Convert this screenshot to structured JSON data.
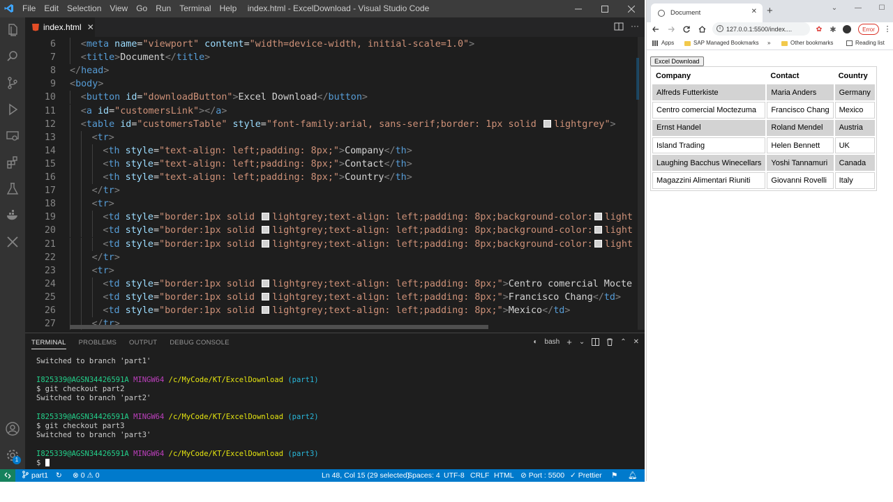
{
  "vscode": {
    "window_title": "index.html - ExcelDownload - Visual Studio Code",
    "menu": [
      "File",
      "Edit",
      "Selection",
      "View",
      "Go",
      "Run",
      "Terminal",
      "Help"
    ],
    "tab_label": "index.html",
    "code_lines": [
      {
        "n": "6",
        "html": "<span class='pun'>&lt;</span><span class='tag'>meta</span> <span class='att'>name</span><span class='txt'>=</span><span class='str'>\"viewport\"</span> <span class='att'>content</span><span class='txt'>=</span><span class='str'>\"width=device-width, initial-scale=1.0\"</span><span class='pun'>&gt;</span>",
        "indent": 2
      },
      {
        "n": "7",
        "html": "<span class='pun'>&lt;</span><span class='tag'>title</span><span class='pun'>&gt;</span><span class='txt'>Document</span><span class='pun'>&lt;/</span><span class='tag'>title</span><span class='pun'>&gt;</span>",
        "indent": 2
      },
      {
        "n": "8",
        "html": "<span class='pun'>&lt;/</span><span class='tag'>head</span><span class='pun'>&gt;</span>",
        "indent": 0
      },
      {
        "n": "9",
        "html": "<span class='pun'>&lt;</span><span class='tag'>body</span><span class='pun'>&gt;</span>",
        "indent": 0
      },
      {
        "n": "10",
        "html": "<span class='pun'>&lt;</span><span class='tag'>button</span> <span class='att'>id</span><span class='txt'>=</span><span class='str'>\"downloadButton\"</span><span class='pun'>&gt;</span><span class='txt'>Excel Download</span><span class='pun'>&lt;/</span><span class='tag'>button</span><span class='pun'>&gt;</span>",
        "indent": 2
      },
      {
        "n": "11",
        "html": "<span class='pun'>&lt;</span><span class='tag'>a</span> <span class='att'>id</span><span class='txt'>=</span><span class='str'>\"customersLink\"</span><span class='pun'>&gt;&lt;/</span><span class='tag'>a</span><span class='pun'>&gt;</span>",
        "indent": 2
      },
      {
        "n": "12",
        "html": "<span class='pun'>&lt;</span><span class='tag'>table</span> <span class='att'>id</span><span class='txt'>=</span><span class='str'>\"customersTable\"</span> <span class='att'>style</span><span class='txt'>=</span><span class='str'>\"font-family:arial, sans-serif;border: 1px solid <span class='sw'></span>lightgrey\"</span><span class='pun'>&gt;</span>",
        "indent": 2
      },
      {
        "n": "13",
        "html": "<span class='pun'>&lt;</span><span class='tag'>tr</span><span class='pun'>&gt;</span>",
        "indent": 4
      },
      {
        "n": "14",
        "html": "<span class='pun'>&lt;</span><span class='tag'>th</span> <span class='att'>style</span><span class='txt'>=</span><span class='str'>\"text-align: left;padding: 8px;\"</span><span class='pun'>&gt;</span><span class='txt'>Company</span><span class='pun'>&lt;/</span><span class='tag'>th</span><span class='pun'>&gt;</span>",
        "indent": 6
      },
      {
        "n": "15",
        "html": "<span class='pun'>&lt;</span><span class='tag'>th</span> <span class='att'>style</span><span class='txt'>=</span><span class='str'>\"text-align: left;padding: 8px;\"</span><span class='pun'>&gt;</span><span class='txt'>Contact</span><span class='pun'>&lt;/</span><span class='tag'>th</span><span class='pun'>&gt;</span>",
        "indent": 6
      },
      {
        "n": "16",
        "html": "<span class='pun'>&lt;</span><span class='tag'>th</span> <span class='att'>style</span><span class='txt'>=</span><span class='str'>\"text-align: left;padding: 8px;\"</span><span class='pun'>&gt;</span><span class='txt'>Country</span><span class='pun'>&lt;/</span><span class='tag'>th</span><span class='pun'>&gt;</span>",
        "indent": 6
      },
      {
        "n": "17",
        "html": "<span class='pun'>&lt;/</span><span class='tag'>tr</span><span class='pun'>&gt;</span>",
        "indent": 4
      },
      {
        "n": "18",
        "html": "<span class='pun'>&lt;</span><span class='tag'>tr</span><span class='pun'>&gt;</span>",
        "indent": 4
      },
      {
        "n": "19",
        "html": "<span class='pun'>&lt;</span><span class='tag'>td</span> <span class='att'>style</span><span class='txt'>=</span><span class='str'>\"border:1px solid <span class='sw'></span>lightgrey;text-align: left;padding: 8px;background-color:<span class='sw'></span>light</span>",
        "indent": 6
      },
      {
        "n": "20",
        "html": "<span class='pun'>&lt;</span><span class='tag'>td</span> <span class='att'>style</span><span class='txt'>=</span><span class='str'>\"border:1px solid <span class='sw'></span>lightgrey;text-align: left;padding: 8px;background-color:<span class='sw'></span>light</span>",
        "indent": 6
      },
      {
        "n": "21",
        "html": "<span class='pun'>&lt;</span><span class='tag'>td</span> <span class='att'>style</span><span class='txt'>=</span><span class='str'>\"border:1px solid <span class='sw'></span>lightgrey;text-align: left;padding: 8px;background-color:<span class='sw'></span>light</span>",
        "indent": 6
      },
      {
        "n": "22",
        "html": "<span class='pun'>&lt;/</span><span class='tag'>tr</span><span class='pun'>&gt;</span>",
        "indent": 4
      },
      {
        "n": "23",
        "html": "<span class='pun'>&lt;</span><span class='tag'>tr</span><span class='pun'>&gt;</span>",
        "indent": 4
      },
      {
        "n": "24",
        "html": "<span class='pun'>&lt;</span><span class='tag'>td</span> <span class='att'>style</span><span class='txt'>=</span><span class='str'>\"border:1px solid <span class='sw'></span>lightgrey;text-align: left;padding: 8px;\"</span><span class='pun'>&gt;</span><span class='txt'>Centro comercial Mocte</span>",
        "indent": 6
      },
      {
        "n": "25",
        "html": "<span class='pun'>&lt;</span><span class='tag'>td</span> <span class='att'>style</span><span class='txt'>=</span><span class='str'>\"border:1px solid <span class='sw'></span>lightgrey;text-align: left;padding: 8px;\"</span><span class='pun'>&gt;</span><span class='txt'>Francisco Chang</span><span class='pun'>&lt;/</span><span class='tag'>td</span><span class='pun'>&gt;</span>",
        "indent": 6
      },
      {
        "n": "26",
        "html": "<span class='pun'>&lt;</span><span class='tag'>td</span> <span class='att'>style</span><span class='txt'>=</span><span class='str'>\"border:1px solid <span class='sw'></span>lightgrey;text-align: left;padding: 8px;\"</span><span class='pun'>&gt;</span><span class='txt'>Mexico</span><span class='pun'>&lt;/</span><span class='tag'>td</span><span class='pun'>&gt;</span>",
        "indent": 6
      },
      {
        "n": "27",
        "html": "<span class='pun'>&lt;/</span><span class='tag'>tr</span><span class='pun'>&gt;</span>",
        "indent": 4
      }
    ],
    "panel_tabs": [
      "TERMINAL",
      "PROBLEMS",
      "OUTPUT",
      "DEBUG CONSOLE"
    ],
    "shell": "bash",
    "terminal_lines": [
      [
        {
          "t": "Switched to branch 'part1'",
          "c": ""
        }
      ],
      [
        {
          "t": "",
          "c": ""
        }
      ],
      [
        {
          "t": "I825339@AGSN34426591A ",
          "c": "tgreen"
        },
        {
          "t": "MINGW64 ",
          "c": "tpurple"
        },
        {
          "t": "/c/MyCode/KT/ExcelDownload ",
          "c": "tyellow"
        },
        {
          "t": "(part1)",
          "c": "tcyan"
        }
      ],
      [
        {
          "t": "$ git checkout part2",
          "c": ""
        }
      ],
      [
        {
          "t": "Switched to branch 'part2'",
          "c": ""
        }
      ],
      [
        {
          "t": "",
          "c": ""
        }
      ],
      [
        {
          "t": "I825339@AGSN34426591A ",
          "c": "tgreen"
        },
        {
          "t": "MINGW64 ",
          "c": "tpurple"
        },
        {
          "t": "/c/MyCode/KT/ExcelDownload ",
          "c": "tyellow"
        },
        {
          "t": "(part2)",
          "c": "tcyan"
        }
      ],
      [
        {
          "t": "$ git checkout part3",
          "c": ""
        }
      ],
      [
        {
          "t": "Switched to branch 'part3'",
          "c": ""
        }
      ],
      [
        {
          "t": "",
          "c": ""
        }
      ],
      [
        {
          "t": "I825339@AGSN34426591A ",
          "c": "tgreen"
        },
        {
          "t": "MINGW64 ",
          "c": "tpurple"
        },
        {
          "t": "/c/MyCode/KT/ExcelDownload ",
          "c": "tyellow"
        },
        {
          "t": "(part3)",
          "c": "tcyan"
        }
      ]
    ],
    "prompt": "$ ",
    "status": {
      "branch": "part1",
      "problems": "⊗ 0 ⚠ 0",
      "position": "Ln 48, Col 15 (29 selected)",
      "spaces": "Spaces: 4",
      "encoding": "UTF-8",
      "eol": "CRLF",
      "language": "HTML",
      "port": "Port : 5500",
      "prettier": "Prettier"
    },
    "accent": "#007acc",
    "badge": "1"
  },
  "chrome": {
    "tab_title": "Document",
    "url": "127.0.0.1:5500/index....",
    "error_label": "Error",
    "bookmarks": {
      "apps": "Apps",
      "sap": "SAP Managed Bookmarks",
      "more": "»",
      "other": "Other bookmarks",
      "reading": "Reading list"
    },
    "page": {
      "button_label": "Excel Download",
      "headers": [
        "Company",
        "Contact",
        "Country"
      ],
      "rows": [
        [
          "Alfreds Futterkiste",
          "Maria Anders",
          "Germany"
        ],
        [
          "Centro comercial Moctezuma",
          "Francisco Chang",
          "Mexico"
        ],
        [
          "Ernst Handel",
          "Roland Mendel",
          "Austria"
        ],
        [
          "Island Trading",
          "Helen Bennett",
          "UK"
        ],
        [
          "Laughing Bacchus Winecellars",
          "Yoshi Tannamuri",
          "Canada"
        ],
        [
          "Magazzini Alimentari Riuniti",
          "Giovanni Rovelli",
          "Italy"
        ]
      ]
    }
  }
}
